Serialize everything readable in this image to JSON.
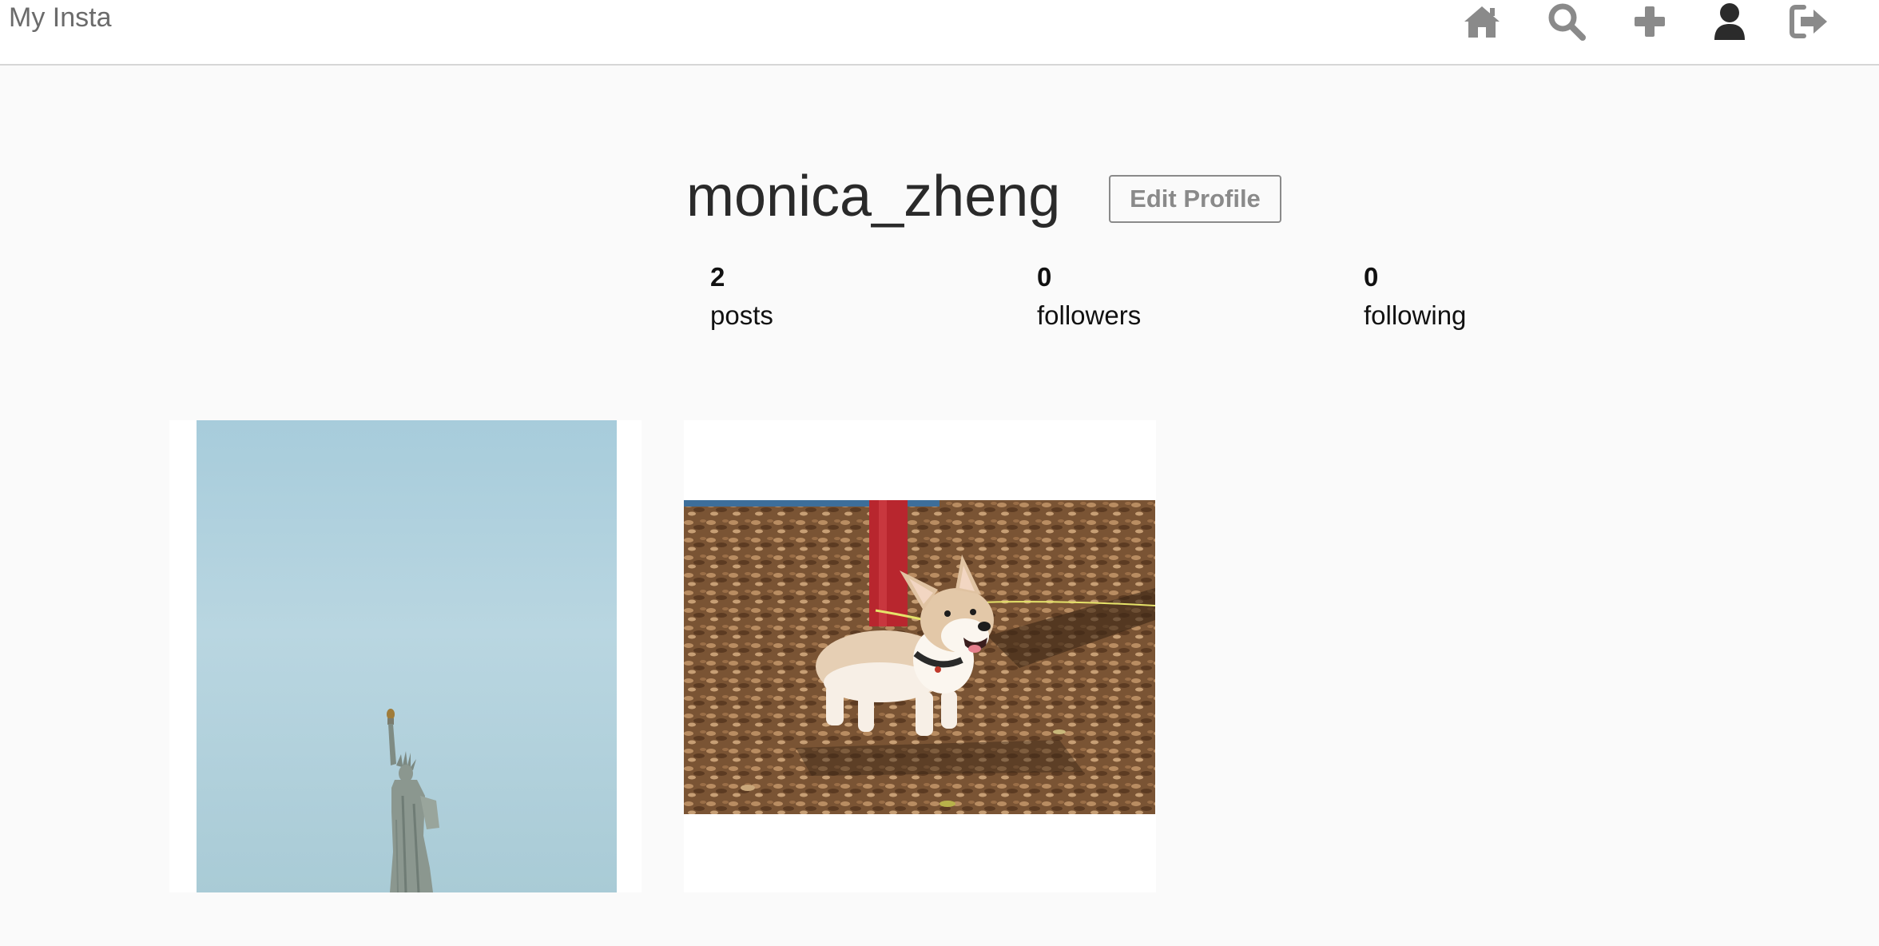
{
  "app": {
    "brand": "My Insta"
  },
  "nav": {
    "icons": [
      "home-icon",
      "search-icon",
      "plus-icon",
      "user-icon",
      "sign-out-icon"
    ],
    "icon_color": "#8a8a8a",
    "active_icon_color": "#2b2b2b"
  },
  "profile": {
    "username": "monica_zheng",
    "edit_label": "Edit Profile",
    "stats": [
      {
        "value": "2",
        "label": "posts"
      },
      {
        "value": "0",
        "label": "followers"
      },
      {
        "value": "0",
        "label": "following"
      }
    ]
  },
  "posts": [
    {
      "subject": "statue-of-liberty"
    },
    {
      "subject": "corgi-dog"
    }
  ]
}
